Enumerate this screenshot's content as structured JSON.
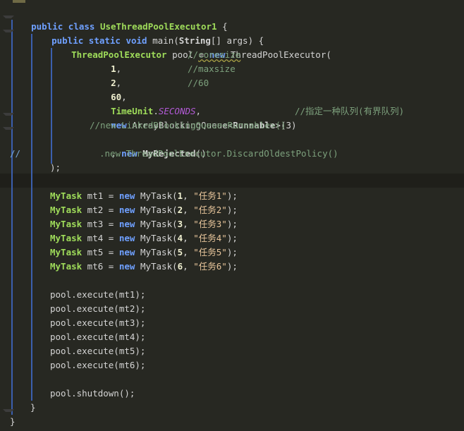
{
  "code": {
    "l1": {
      "kw1": "public",
      "kw2": "class",
      "cls": "UseThreadPoolExecutor1",
      "punc": " {"
    },
    "l2": {
      "kw1": "public",
      "kw2": "static",
      "kw3": "void",
      "name": " main(",
      "type": "String",
      "rest": "[] args) {"
    },
    "l3": {
      "type": "ThreadPoolExecutor",
      "mid": " pool = ",
      "kw": "new",
      "rest": " ThreadPoolExecutor("
    },
    "l4": {
      "num": "1",
      "punc": ",",
      "comment": "//",
      "ann": "coresize"
    },
    "l5": {
      "num": "2",
      "punc": ",",
      "comment": "//maxsize"
    },
    "l6": {
      "num": "60",
      "punc": ",",
      "comment": "//60"
    },
    "l7": {
      "cls": "TimeUnit",
      "dot": ".",
      "const": "SECONDS",
      "punc": ","
    },
    "l8": {
      "kw": "new",
      "mid": " ArrayBlockingQueue<",
      "cls": "Runnable",
      "rest": ">(3)",
      "comment": "//指定一种队列(有界队列)"
    },
    "l9": {
      "comment": "//new LinkedBlockingQueue<Runnable>()"
    },
    "l10": {
      "pre": ", ",
      "kw": "new",
      "cls": "MyRejected",
      "rest": "()"
    },
    "l11": {
      "slash": "//",
      "comment": ".new ThreadPoolExecutor.DiscardOldestPolicy()"
    },
    "l12": {
      "text": ");"
    },
    "tasks": [
      {
        "type": "MyTask",
        "var": " mt1 = ",
        "kw": "new",
        "ctor": " MyTask(",
        "num": "1",
        "sep": ", ",
        "str": "\"任务1\"",
        "end": ");"
      },
      {
        "type": "MyTask",
        "var": " mt2 = ",
        "kw": "new",
        "ctor": " MyTask(",
        "num": "2",
        "sep": ", ",
        "str": "\"任务2\"",
        "end": ");"
      },
      {
        "type": "MyTask",
        "var": " mt3 = ",
        "kw": "new",
        "ctor": " MyTask(",
        "num": "3",
        "sep": ", ",
        "str": "\"任务3\"",
        "end": ");"
      },
      {
        "type": "MyTask",
        "var": " mt4 = ",
        "kw": "new",
        "ctor": " MyTask(",
        "num": "4",
        "sep": ", ",
        "str": "\"任务4\"",
        "end": ");"
      },
      {
        "type": "MyTask",
        "var": " mt5 = ",
        "kw": "new",
        "ctor": " MyTask(",
        "num": "5",
        "sep": ", ",
        "str": "\"任务5\"",
        "end": ");"
      },
      {
        "type": "MyTask",
        "var": " mt6 = ",
        "kw": "new",
        "ctor": " MyTask(",
        "num": "6",
        "sep": ", ",
        "str": "\"任务6\"",
        "end": ");"
      }
    ],
    "executes": [
      "pool.execute(mt1);",
      "pool.execute(mt2);",
      "pool.execute(mt3);",
      "pool.execute(mt4);",
      "pool.execute(mt5);",
      "pool.execute(mt6);"
    ],
    "shutdown": "pool.shutdown();",
    "close_method": "}",
    "close_class": "}"
  }
}
